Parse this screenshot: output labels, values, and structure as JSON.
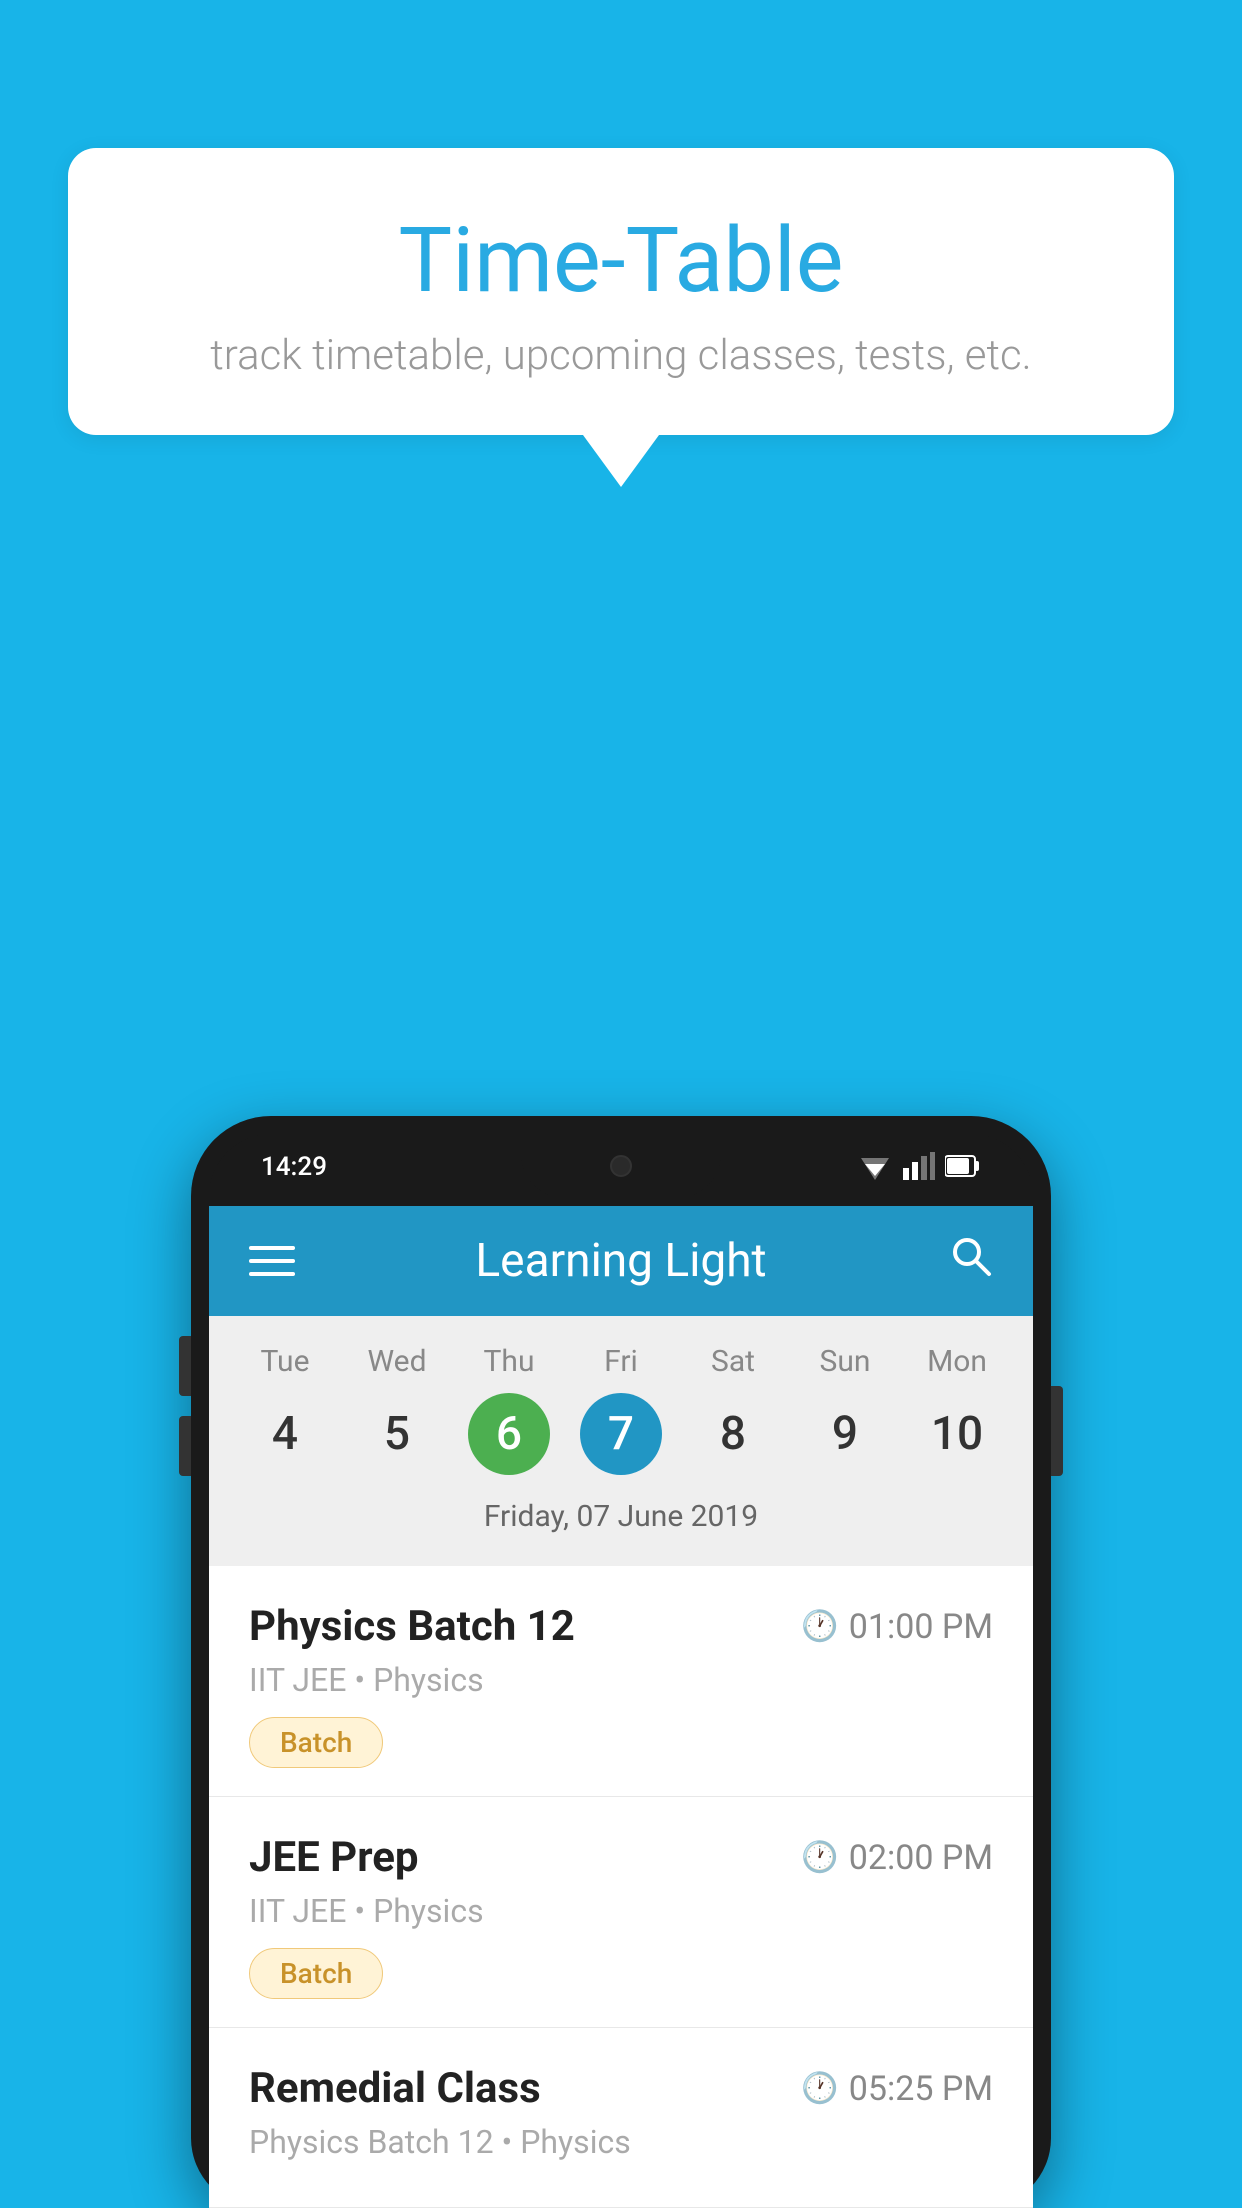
{
  "background_color": "#18b4e8",
  "bubble": {
    "title": "Time-Table",
    "subtitle": "track timetable, upcoming classes, tests, etc."
  },
  "app": {
    "name": "Learning Light",
    "time": "14:29"
  },
  "calendar": {
    "days": [
      {
        "name": "Tue",
        "num": "4",
        "state": "normal"
      },
      {
        "name": "Wed",
        "num": "5",
        "state": "normal"
      },
      {
        "name": "Thu",
        "num": "6",
        "state": "today"
      },
      {
        "name": "Fri",
        "num": "7",
        "state": "selected"
      },
      {
        "name": "Sat",
        "num": "8",
        "state": "normal"
      },
      {
        "name": "Sun",
        "num": "9",
        "state": "normal"
      },
      {
        "name": "Mon",
        "num": "10",
        "state": "normal"
      }
    ],
    "selected_date_label": "Friday, 07 June 2019"
  },
  "schedule": [
    {
      "title": "Physics Batch 12",
      "time": "01:00 PM",
      "subtitle": "IIT JEE • Physics",
      "tag": "Batch"
    },
    {
      "title": "JEE Prep",
      "time": "02:00 PM",
      "subtitle": "IIT JEE • Physics",
      "tag": "Batch"
    },
    {
      "title": "Remedial Class",
      "time": "05:25 PM",
      "subtitle": "Physics Batch 12 • Physics",
      "tag": ""
    }
  ]
}
